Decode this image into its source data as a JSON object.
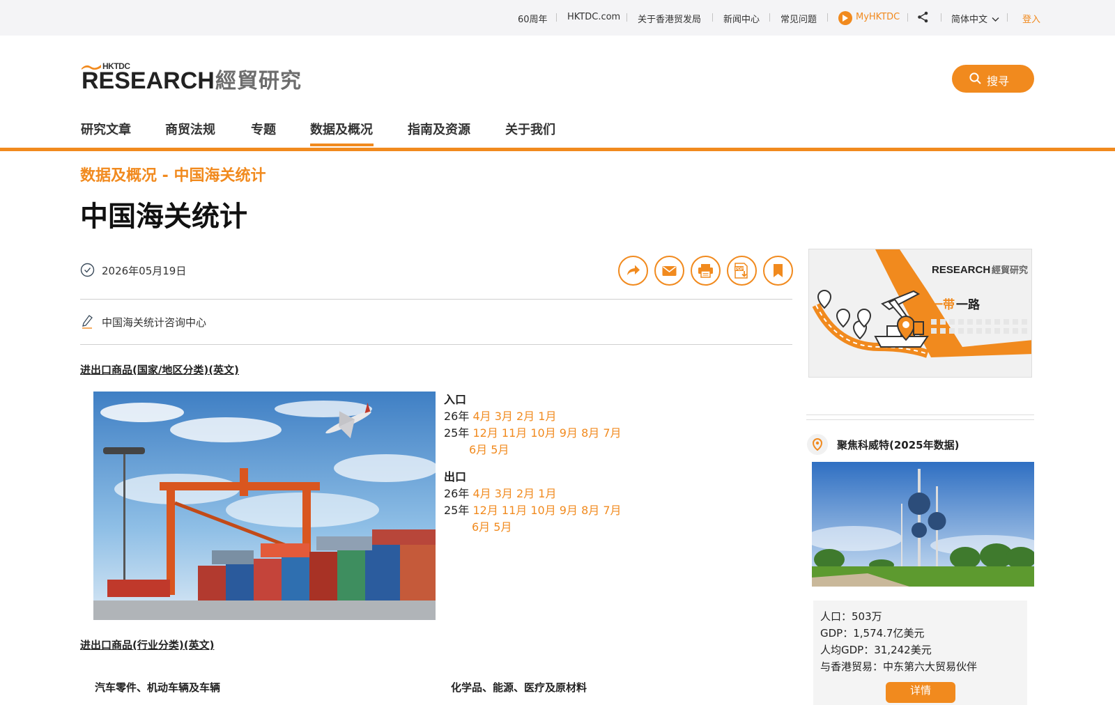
{
  "topbar": {
    "items": [
      "60周年",
      "HKTDC.com",
      "关于香港贸发局",
      "新闻中心",
      "常见问题"
    ],
    "myhktdc": "MyHKTDC",
    "language": "简体中文",
    "login": "登入"
  },
  "header": {
    "logo_brand": "HKTDC",
    "logo_research": "RESEARCH",
    "logo_cn": "經貿研究",
    "search_label": "搜寻"
  },
  "nav": {
    "items": [
      "研究文章",
      "商贸法规",
      "专题",
      "数据及概况",
      "指南及资源",
      "关于我们"
    ],
    "active": "数据及概况"
  },
  "page": {
    "breadcrumb": "数据及概况 - 中国海关统计",
    "title": "中国海关统计",
    "date": "2026年05月19日",
    "author": "中国海关统计咨询中心"
  },
  "content": {
    "section1": "进出口商品(国家/地区分类)(英文)",
    "section2": "进出口商品(行业分类)(英文)",
    "imports": {
      "heading": "入口",
      "y26": "26年",
      "y26_months": "4月 3月 2月 1月",
      "y25": "25年",
      "y25_months": "12月 11月 10月 9月 8月 7月",
      "y25_months_cont": "6月 5月"
    },
    "exports": {
      "heading": "出口",
      "y26": "26年",
      "y26_months": "4月 3月 2月 1月",
      "y25": "25年",
      "y25_months": "12月 11月 10月 9月 8月 7月",
      "y25_months_cont": "6月 5月"
    },
    "categories": [
      "汽车零件、机动车辆及车辆",
      "化学品、能源、医疗及原材料"
    ]
  },
  "sidebar": {
    "banner": {
      "logo_research": "RESEARCH",
      "logo_cn": "經貿研究",
      "title_highlight": "一带",
      "title_rest": "一路"
    },
    "focus_title": "聚焦科威特(2025年数据)",
    "facts": [
      "人口：503万",
      "GDP：1,574.7亿美元",
      "人均GDP：31,242美元",
      "与香港贸易：中东第六大贸易伙伴"
    ],
    "detail_button": "详情"
  },
  "colors": {
    "accent": "#f18a1e",
    "topbar_bg": "#f4f4f6",
    "text": "#222222"
  },
  "icons": [
    "share-icon",
    "chevron-down-icon",
    "search-icon",
    "clock-icon",
    "forward-icon",
    "mail-icon",
    "print-icon",
    "pdf-download-icon",
    "bookmark-icon",
    "pen-icon",
    "location-pin-icon"
  ]
}
